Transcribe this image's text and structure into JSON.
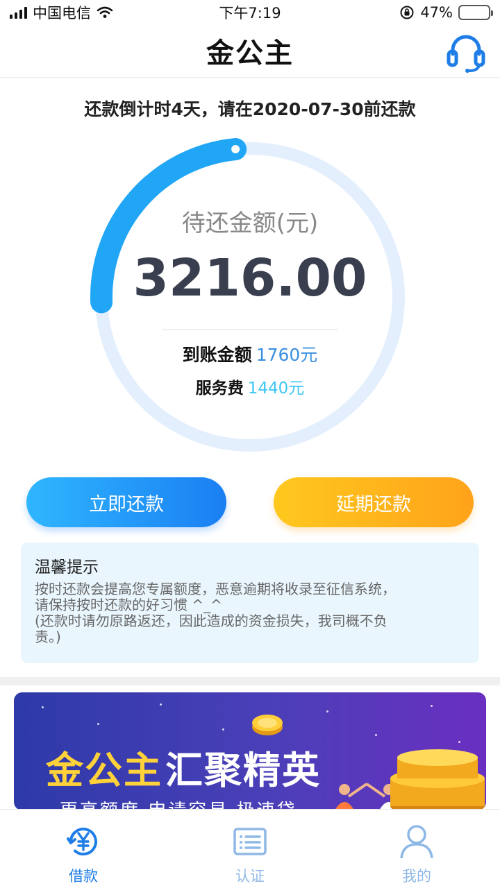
{
  "status_bar": {
    "carrier": "中国电信",
    "time": "下午7:19",
    "battery": "47%",
    "battery_level": 0.47
  },
  "header": {
    "title": "金公主",
    "cs_icon": "headset-icon"
  },
  "countdown": "还款倒计时4天，请在2020-07-30前还款",
  "ring": {
    "pending_label": "待还金额(元)",
    "amount": "3216.00",
    "progress": 0.24,
    "received_label": "到账金额",
    "received_value": "1760元",
    "fee_label": "服务费",
    "fee_value": "1440元"
  },
  "buttons": {
    "repay": "立即还款",
    "extend": "延期还款"
  },
  "tips": {
    "title": "温馨提示",
    "lines": [
      "按时还款会提高您专属额度，恶意逾期将收录至征信系统，",
      "请保持按时还款的好习惯 ^_^",
      "(还款时请勿原路返还，因此造成的资金损失，我司概不负",
      "责。)"
    ]
  },
  "banner": {
    "brand": "金公主",
    "slogan": "汇聚精英",
    "sub": "更高额度 申请容易 极速贷"
  },
  "nav": [
    {
      "label": "借款",
      "icon": "yen-refresh-icon",
      "active": true
    },
    {
      "label": "认证",
      "icon": "id-card-icon",
      "active": false
    },
    {
      "label": "我的",
      "icon": "user-icon",
      "active": false
    }
  ],
  "colors": {
    "primary": "#1e7de6",
    "accent_orange": "#ffa31a",
    "ring_track": "#e3effc",
    "ring_progress": "#21a6f5"
  }
}
